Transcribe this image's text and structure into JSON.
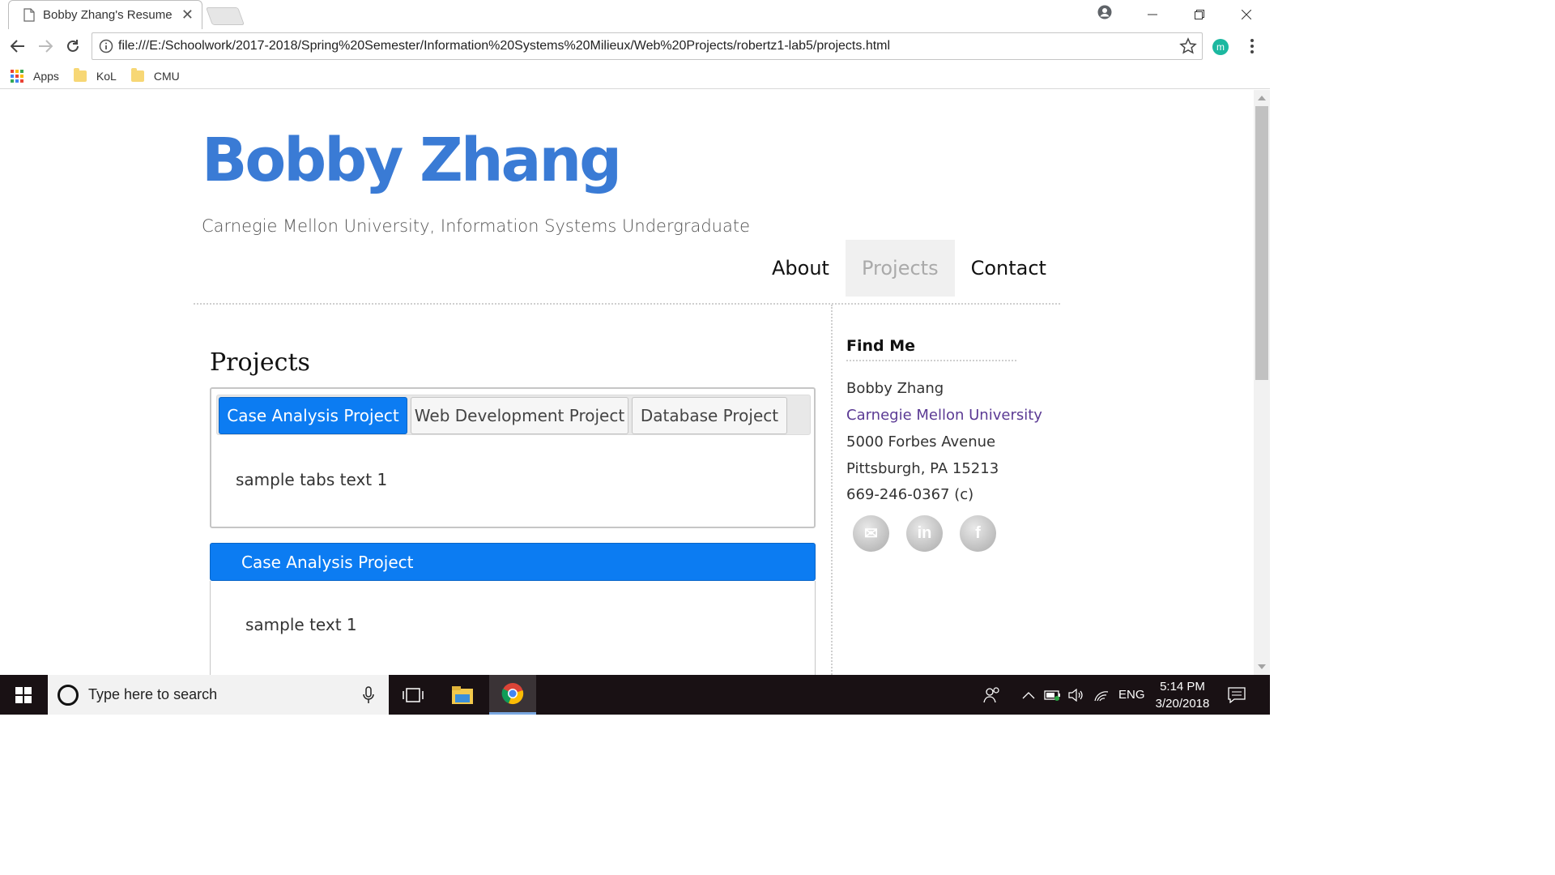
{
  "browser": {
    "tab_title": "Bobby Zhang's Resume",
    "url": "file:///E:/Schoolwork/2017-2018/Spring%20Semester/Information%20Systems%20Milieux/Web%20Projects/robertz1-lab5/projects.html",
    "extension_letter": "m",
    "bookmarks": [
      {
        "label": "Apps",
        "icon": "apps-grid-icon"
      },
      {
        "label": "KoL",
        "icon": "folder-icon"
      },
      {
        "label": "CMU",
        "icon": "folder-icon"
      }
    ]
  },
  "site": {
    "title": "Bobby Zhang",
    "subtitle": "Carnegie Mellon University, Information Systems Undergraduate",
    "nav": [
      {
        "label": "About",
        "active": false
      },
      {
        "label": "Projects",
        "active": true
      },
      {
        "label": "Contact",
        "active": false
      }
    ]
  },
  "main": {
    "section_title": "Projects",
    "tabs": [
      {
        "label": "Case Analysis Project",
        "active": true
      },
      {
        "label": "Web Development Project",
        "active": false
      },
      {
        "label": "Database Project",
        "active": false
      }
    ],
    "tab_content": "sample tabs text 1",
    "accordion": {
      "header": "Case Analysis Project",
      "content": "sample text 1"
    }
  },
  "sidebar": {
    "title": "Find Me",
    "name": "Bobby Zhang",
    "school": "Carnegie Mellon University",
    "street": "5000 Forbes Avenue",
    "city": "Pittsburgh, PA 15213",
    "phone": "669-246-0367 (c)",
    "social": [
      {
        "icon": "email-icon",
        "glyph": "✉"
      },
      {
        "icon": "linkedin-icon",
        "glyph": "in"
      },
      {
        "icon": "facebook-icon",
        "glyph": "f"
      }
    ]
  },
  "taskbar": {
    "search_placeholder": "Type here to search",
    "language": "ENG",
    "time": "5:14 PM",
    "date": "3/20/2018"
  },
  "colors": {
    "accent_blue": "#0c7cf2",
    "title_blue": "#3a7bd5",
    "link_purple": "#5b3a94"
  }
}
